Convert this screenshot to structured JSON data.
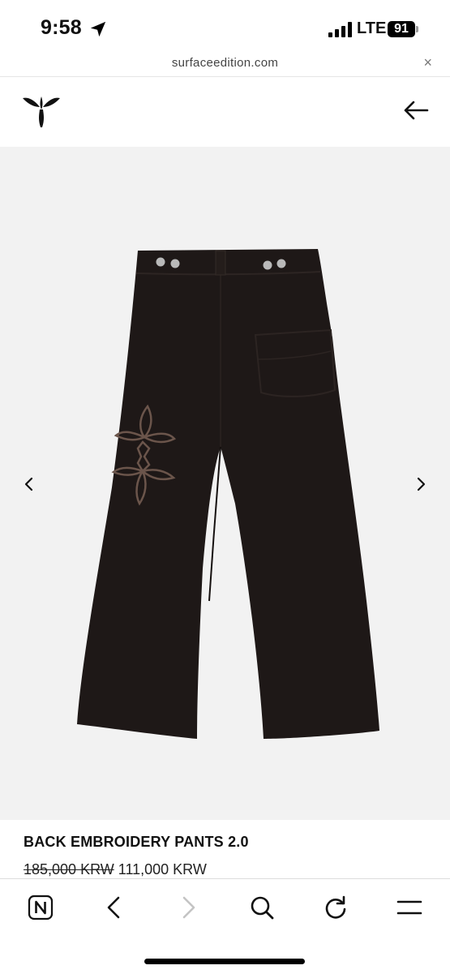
{
  "status_bar": {
    "time": "9:58",
    "network": "LTE",
    "battery": "91"
  },
  "browser": {
    "url": "surfaceedition.com",
    "close_symbol": "×"
  },
  "header": {
    "logo_icon": "brand-logo-icon",
    "back_icon": "arrow-left-icon"
  },
  "gallery": {
    "prev_icon": "chevron-left-icon",
    "next_icon": "chevron-right-icon"
  },
  "product": {
    "title": "BACK EMBROIDERY PANTS 2.0",
    "original_price": "185,000 KRW",
    "sale_price": "111,000 KRW"
  },
  "toolbar": {
    "items": [
      "naver-icon",
      "back-icon",
      "forward-icon",
      "search-icon",
      "reload-icon",
      "menu-icon"
    ]
  },
  "colors": {
    "pants": "#1e1817",
    "embroidery": "#6b554b",
    "background": "#f2f2f2"
  }
}
